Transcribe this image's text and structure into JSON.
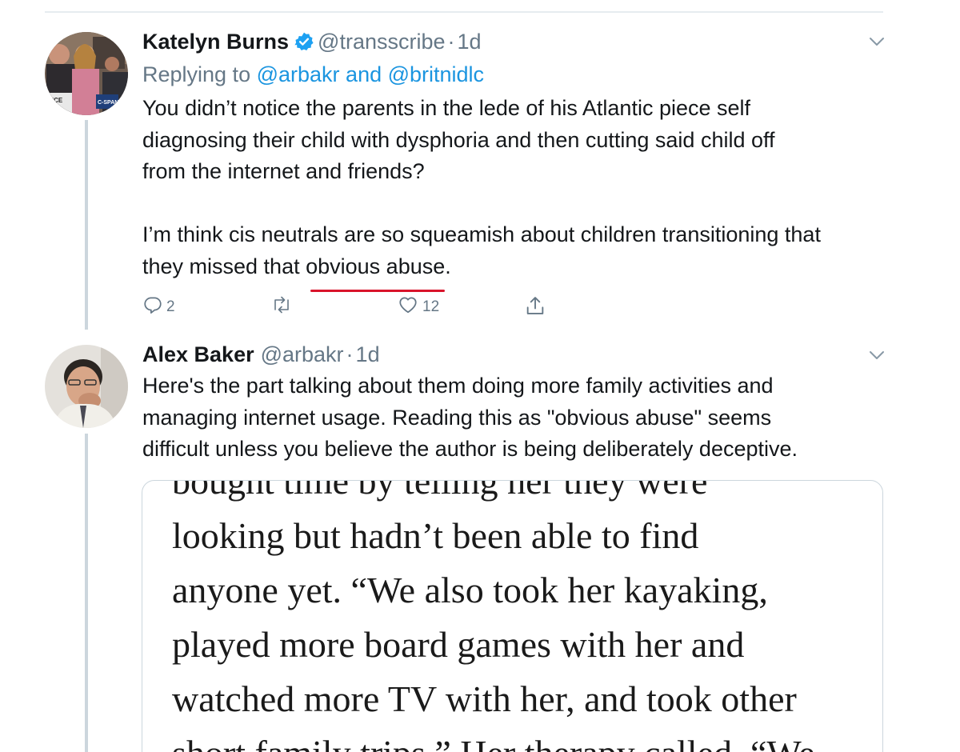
{
  "tweets": [
    {
      "display_name": "Katelyn Burns",
      "verified": true,
      "handle": "@transscribe",
      "separator": "·",
      "time": "1d",
      "replying_prefix": "Replying to ",
      "replying_user1": "@arbakr",
      "replying_and": " and ",
      "replying_user2": "@britnidlc",
      "text_lines": [
        "You didn’t notice the parents in the lede of his Atlantic piece self",
        "diagnosing their child with dysphoria and then cutting said child off",
        "from the internet and friends?"
      ],
      "text_line4_pre": "I’m think cis neutrals are so squeamish about children transitioning that",
      "text_line5_pre": "they missed that ",
      "text_line5_highlight": "obvious abuse",
      "text_line5_post": ".",
      "reply_count": "2",
      "retweet_count": "",
      "like_count": "12"
    },
    {
      "display_name": "Alex Baker",
      "verified": false,
      "handle": "@arbakr",
      "separator": "·",
      "time": "1d",
      "text_lines": [
        "Here's the part talking about them doing more family activities and",
        "managing internet usage. Reading this as \"obvious abuse\" seems",
        "difficult unless you believe the author is being deliberately deceptive."
      ],
      "media_lines": [
        "bought time by telling her they were",
        "looking but hadn’t been able to find",
        "anyone yet. “We also took her kayaking,",
        "played more board games with her and",
        "watched more TV with her, and took other",
        "short family trips.” Her therapy called, “We"
      ]
    }
  ],
  "icons": {
    "verified": "verified-badge-icon",
    "more": "chevron-down-icon",
    "reply": "reply-icon",
    "retweet": "retweet-icon",
    "like": "heart-icon",
    "share": "share-icon"
  },
  "colors": {
    "link": "#1b95e0",
    "meta": "#657786",
    "text": "#14171a",
    "thread_line": "#ccd6dd",
    "highlight_underline": "#d9142b"
  }
}
